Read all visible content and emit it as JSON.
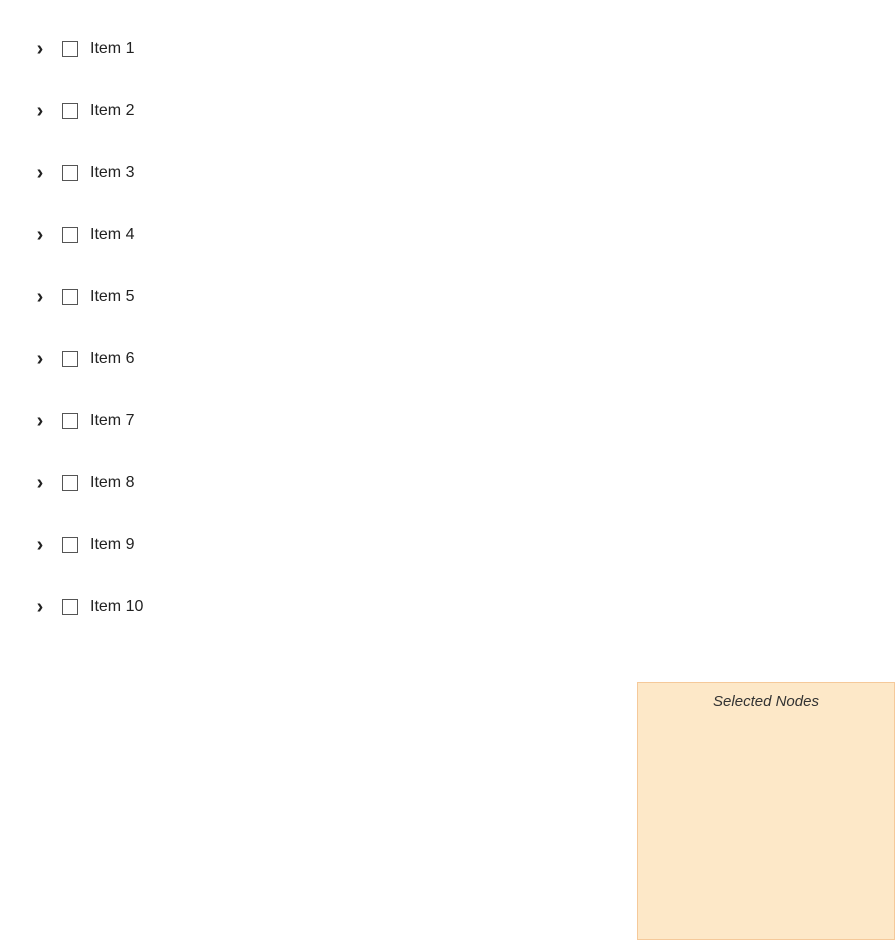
{
  "tree": {
    "items": [
      {
        "id": 1,
        "label": "Item 1",
        "checked": false
      },
      {
        "id": 2,
        "label": "Item 2",
        "checked": false
      },
      {
        "id": 3,
        "label": "Item 3",
        "checked": false
      },
      {
        "id": 4,
        "label": "Item 4",
        "checked": false
      },
      {
        "id": 5,
        "label": "Item 5",
        "checked": false
      },
      {
        "id": 6,
        "label": "Item 6",
        "checked": false
      },
      {
        "id": 7,
        "label": "Item 7",
        "checked": false
      },
      {
        "id": 8,
        "label": "Item 8",
        "checked": false
      },
      {
        "id": 9,
        "label": "Item 9",
        "checked": false
      },
      {
        "id": 10,
        "label": "Item 10",
        "checked": false
      }
    ]
  },
  "selected_nodes_panel": {
    "title": "Selected Nodes"
  }
}
